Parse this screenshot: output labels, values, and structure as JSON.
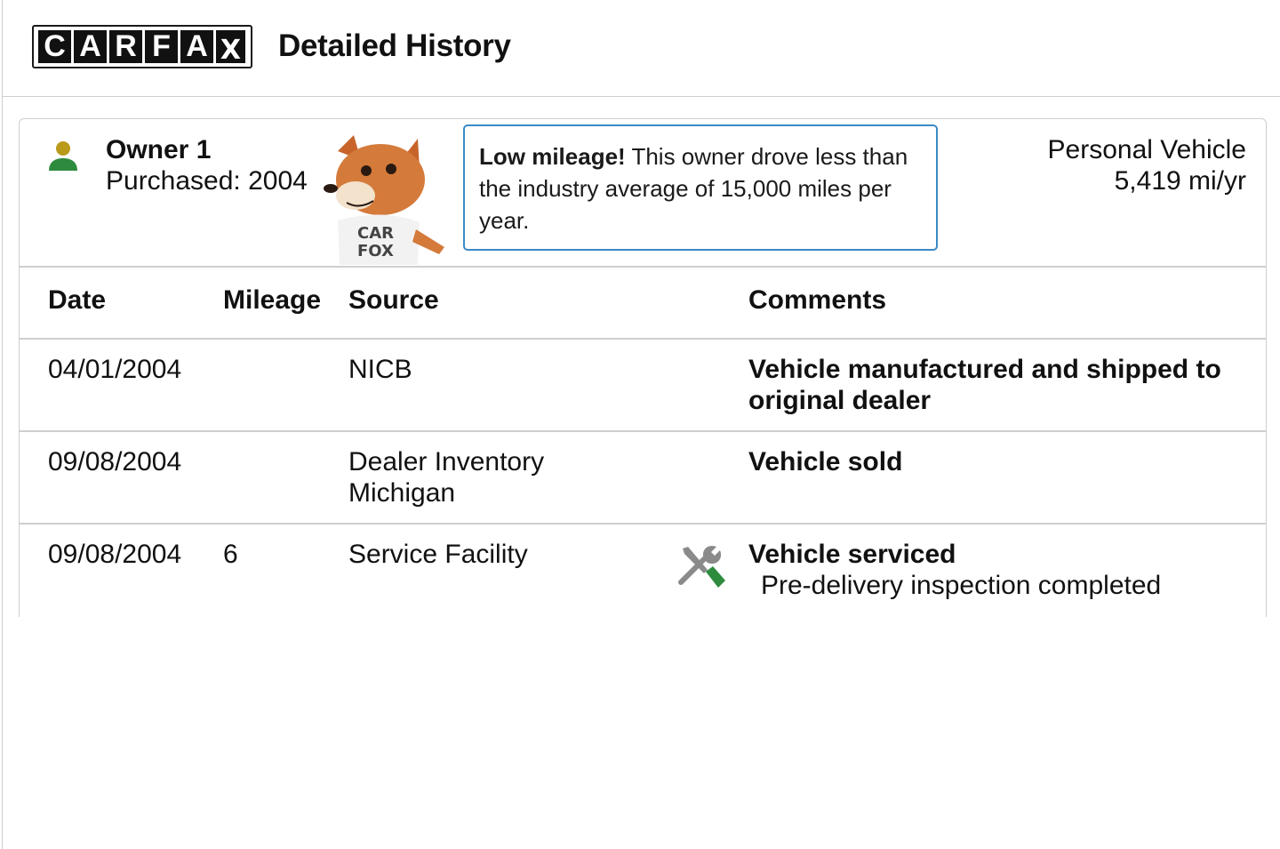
{
  "header": {
    "logo_letters": [
      "C",
      "A",
      "R",
      "F",
      "A",
      "X"
    ],
    "title": "Detailed History"
  },
  "owner": {
    "icon": "person-icon",
    "name": "Owner 1",
    "purchased": "Purchased: 2004",
    "callout_bold": "Low mileage!",
    "callout_text": " This owner drove less than the industry average of 15,000 miles per year.",
    "vehicle_type": "Personal Vehicle",
    "mileage_rate": "5,419 mi/yr"
  },
  "table": {
    "headers": [
      "Date",
      "Mileage",
      "Source",
      "Comments"
    ],
    "rows": [
      {
        "date": "04/01/2004",
        "mileage": "",
        "source_line1": "NICB",
        "source_line2": "",
        "comment": "Vehicle manufactured and shipped to original dealer",
        "comment_detail": ""
      },
      {
        "date": "09/08/2004",
        "mileage": "",
        "source_line1": "Dealer Inventory",
        "source_line2": "Michigan",
        "comment": "Vehicle sold",
        "comment_detail": ""
      },
      {
        "date": "09/08/2004",
        "mileage": "6",
        "source_line1": "Service Facility",
        "source_line2": "",
        "icon": "service-tools-icon",
        "comment": "Vehicle serviced",
        "comment_detail": "Pre-delivery inspection completed"
      }
    ]
  },
  "colors": {
    "owner_icon_head": "#b99a1a",
    "owner_icon_body": "#2e8b3e",
    "callout_border": "#3a8ac7",
    "service_icon_gray": "#8a8a8a",
    "service_icon_green": "#2e8b3e"
  }
}
